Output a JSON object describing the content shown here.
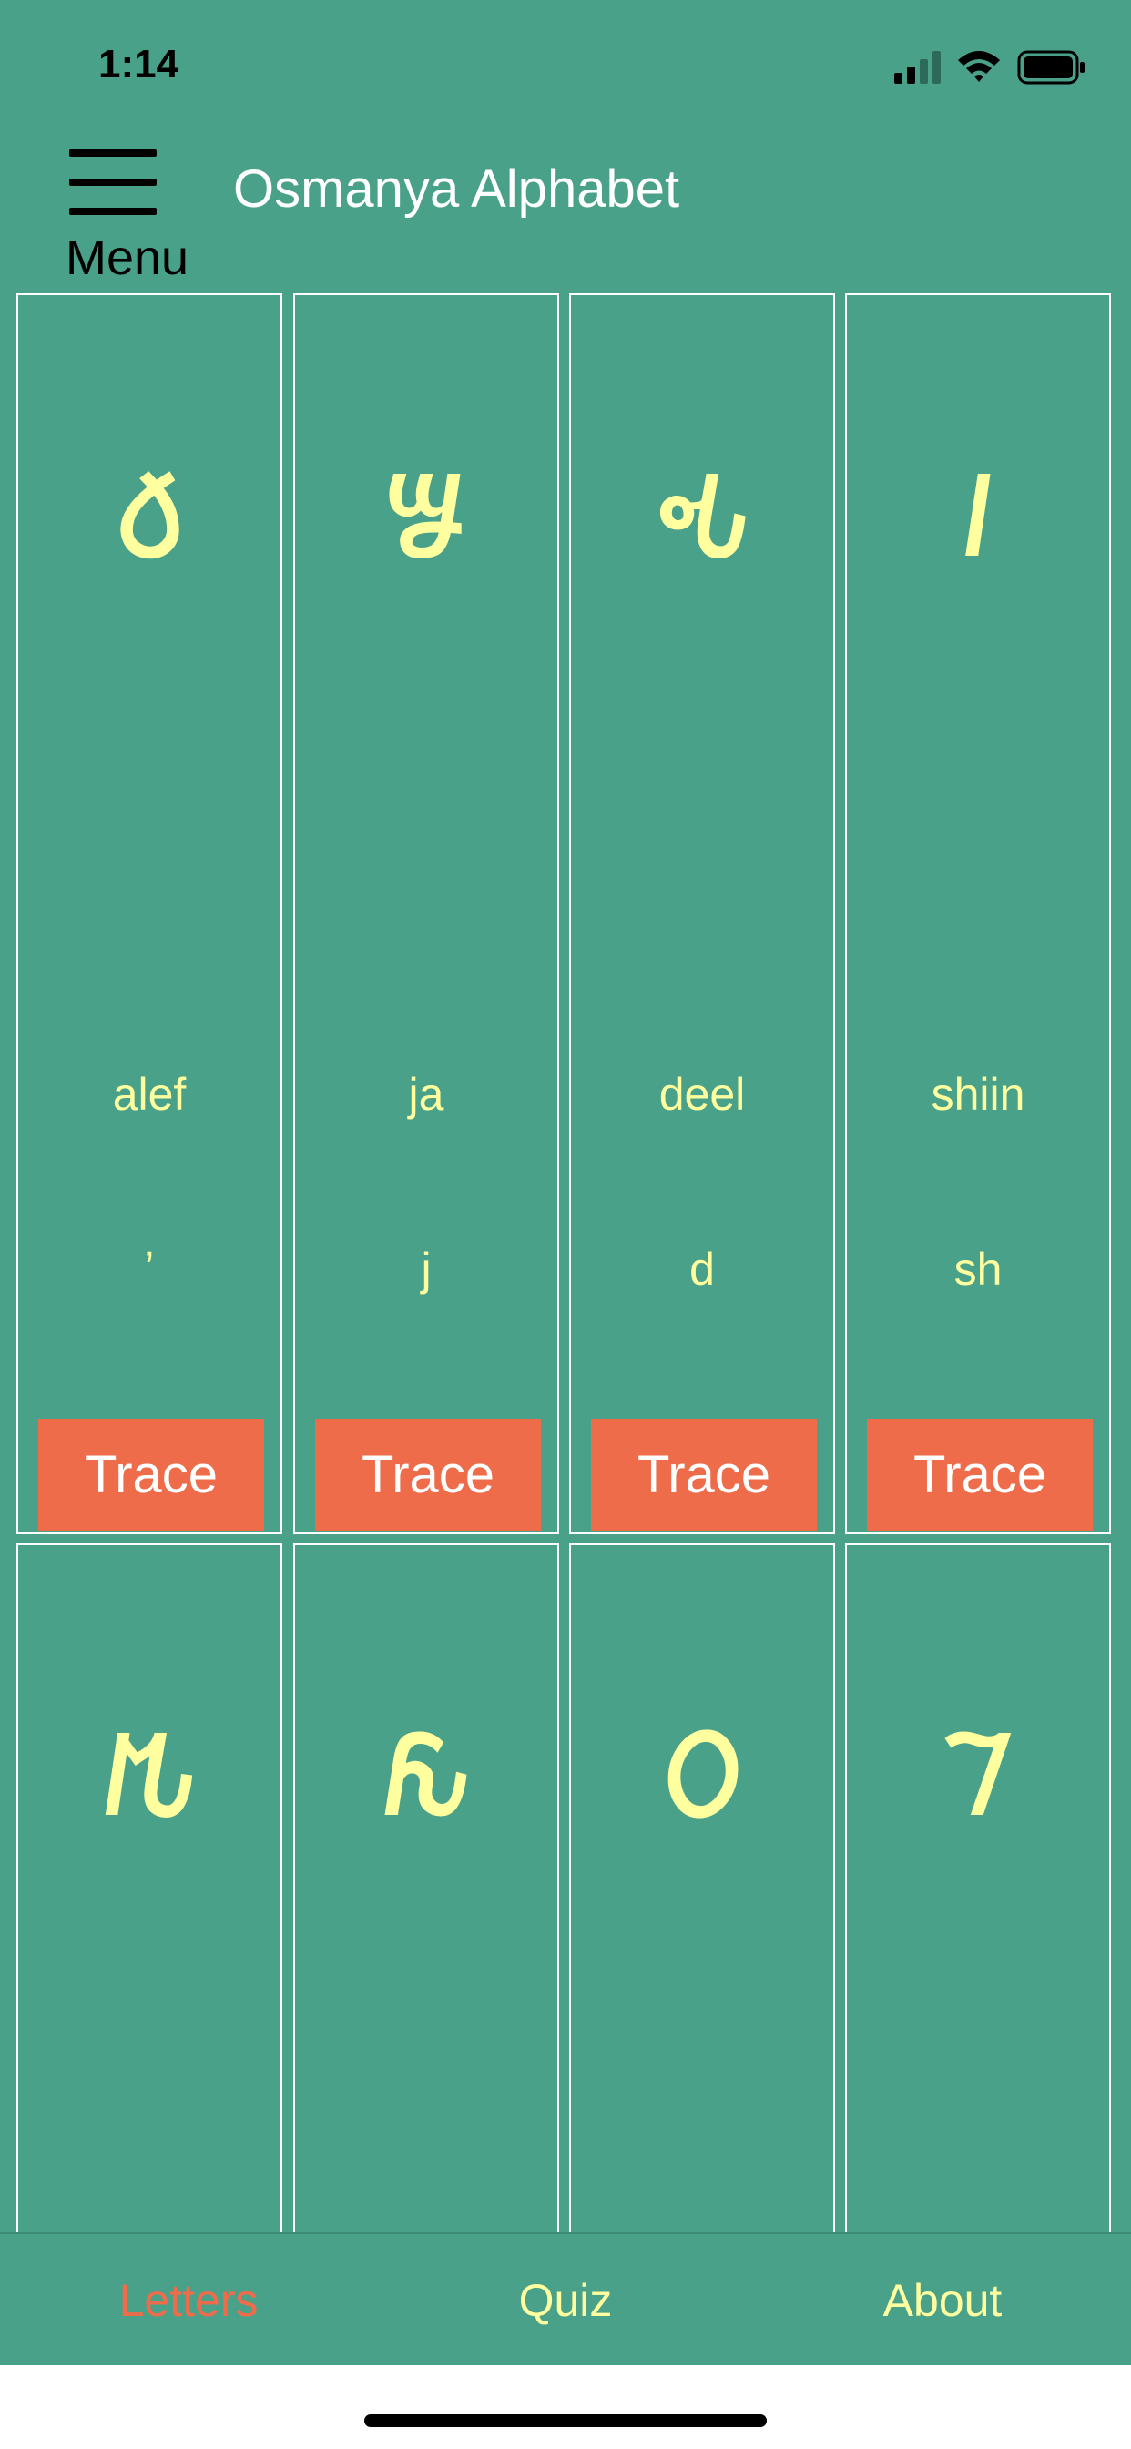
{
  "status": {
    "time": "1:14"
  },
  "header": {
    "menu_label": "Menu",
    "title": "Osmanya Alphabet"
  },
  "letters": [
    {
      "glyph": "𐒀",
      "name": "alef",
      "translit": "ʼ",
      "trace_label": "Trace"
    },
    {
      "glyph": "𐒁",
      "name": "ja",
      "translit": "j",
      "trace_label": "Trace"
    },
    {
      "glyph": "𐒂",
      "name": "deel",
      "translit": "d",
      "trace_label": "Trace"
    },
    {
      "glyph": "𐒃",
      "name": "shiin",
      "translit": "sh",
      "trace_label": "Trace"
    },
    {
      "glyph": "𐒄"
    },
    {
      "glyph": "𐒅"
    },
    {
      "glyph": "𐒆"
    },
    {
      "glyph": "𐒇"
    }
  ],
  "tabs": [
    {
      "label": "Letters",
      "active": true
    },
    {
      "label": "Quiz",
      "active": false
    },
    {
      "label": "About",
      "active": false
    }
  ],
  "colors": {
    "background": "#4aa189",
    "glyph": "#ffff9f",
    "trace_button": "#ee6c4a",
    "active_tab": "#ee6c4a",
    "inactive_tab": "#ffff9f"
  },
  "icons": [
    "signal-icon",
    "wifi-icon",
    "battery-icon",
    "hamburger-menu-icon"
  ]
}
